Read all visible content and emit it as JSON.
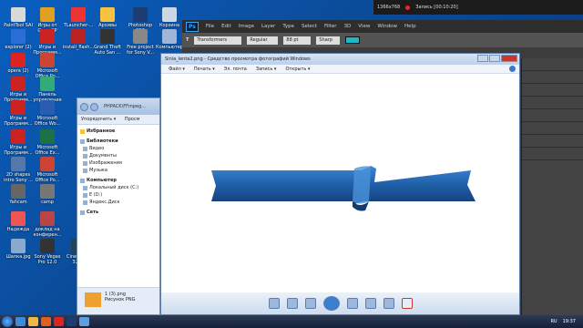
{
  "desktop": {
    "icons": [
      {
        "label": "PaintTool SAI",
        "color": "#d9d9d9"
      },
      {
        "label": "Игры от GameXP",
        "color": "#e0a020"
      },
      {
        "label": "TLauncher-...",
        "color": "#e33"
      },
      {
        "label": "Архивы",
        "color": "#f5c542"
      },
      {
        "label": "Photoshop CS6",
        "color": "#1c3d73"
      },
      {
        "label": "Корзина",
        "color": "#cfd7e3"
      },
      {
        "label": "explorer (2)",
        "color": "#2b6fd6"
      },
      {
        "label": "Игры и Программ...",
        "color": "#c22"
      },
      {
        "label": "install_flash...",
        "color": "#b22"
      },
      {
        "label": "Grand Theft Auto San ...",
        "color": "#333"
      },
      {
        "label": "Free project for Sony V...",
        "color": "#888"
      },
      {
        "label": "Компьютер",
        "color": "#9fb6d6"
      },
      {
        "label": "opera (2)",
        "color": "#d22"
      },
      {
        "label": "Microsoft Office Po...",
        "color": "#c43"
      },
      {
        "label": "Игры и Программ...",
        "color": "#c22"
      },
      {
        "label": "Панель управления",
        "color": "#3a7"
      },
      {
        "label": "Игры и Программ...",
        "color": "#c22"
      },
      {
        "label": "Microsoft Office Wo...",
        "color": "#2a5db0"
      },
      {
        "label": "Игры и Программ...",
        "color": "#c22"
      },
      {
        "label": "Microsoft Office Ex...",
        "color": "#1e7145"
      },
      {
        "label": "2D shapes intro Sony ...",
        "color": "#57a"
      },
      {
        "label": "Microsoft Office Po...",
        "color": "#c43"
      },
      {
        "label": "Yahcam",
        "color": "#666"
      },
      {
        "label": "camp",
        "color": "#777"
      },
      {
        "label": "Надежда",
        "color": "#e55"
      },
      {
        "label": "доклад на конферен...",
        "color": "#b44"
      },
      {
        "label": "Шапка.jpg",
        "color": "#8ac"
      },
      {
        "label": "Sony Vegas Pro 12.0",
        "color": "#333"
      },
      {
        "label": "Cinema4D 32Bit",
        "color": "#245"
      },
      {
        "label": "Cinema4D 64Bit",
        "color": "#245"
      },
      {
        "label": "Cinema4D",
        "color": "#245"
      }
    ]
  },
  "recorder": {
    "resolution": "1366x768",
    "status": "Запись [00:10:20]"
  },
  "photoshop": {
    "logo": "Ps",
    "menu": [
      "File",
      "Edit",
      "Image",
      "Layer",
      "Type",
      "Select",
      "Filter",
      "3D",
      "View",
      "Window",
      "Help"
    ],
    "options": {
      "font": "Transformers",
      "style": "Regular",
      "size": "88 pt",
      "aa": "Sharp"
    },
    "accent": "#1bb8c7"
  },
  "explorer": {
    "address": "PHPACK\\FFmpeg...",
    "toolbar": {
      "organize": "Упорядочить ▾",
      "view": "Просм"
    },
    "favorites": "Избранное",
    "libraries": {
      "title": "Библиотеки",
      "items": [
        "Видео",
        "Документы",
        "Изображения",
        "Музыка"
      ]
    },
    "computer": {
      "title": "Компьютер",
      "items": [
        "Локальный диск (C:)",
        "E (D:)",
        "Яндекс.Диск"
      ]
    },
    "network": "Сеть",
    "preview": {
      "name": "1 (3).png",
      "type": "Рисунок PNG"
    }
  },
  "viewer": {
    "title": "Sinia_lenta2.png - Средство просмотра фотографий Windows",
    "menu": [
      "Файл ▾",
      "Печать ▾",
      "Эл. почта",
      "Запись ▾",
      "Открыть ▾"
    ],
    "ribbon_color": "#1f5fa8"
  },
  "taskbar": {
    "lang": "RU",
    "time": "19:37"
  }
}
